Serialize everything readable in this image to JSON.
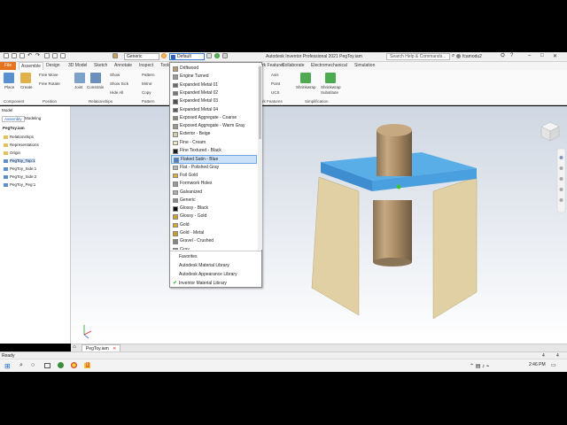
{
  "title_bar": {
    "material_combo": "Generic",
    "appearance_combo": "Default",
    "app_title": "Autodesk Inventor Professional 2021   PegToy.iam",
    "search_placeholder": "Search Help & Commands...",
    "user": "fcamodu2"
  },
  "ribbon_tabs": [
    "File",
    "Assemble",
    "Design",
    "3D Model",
    "Sketch",
    "Annotate",
    "Inspect",
    "Tools",
    "rk Features",
    "Collaborate",
    "Electromechanical",
    "Simulation"
  ],
  "ribbon": {
    "place": "Place",
    "create": "Create",
    "free_move": "Free Move",
    "free_rotate": "Free Rotate",
    "joint": "Joint",
    "constrain": "Constrain",
    "show": "Show",
    "show_sick": "Show Sick",
    "hide_all": "Hide All",
    "pattern": "Pattern",
    "mirror": "Mirror",
    "copy": "Copy",
    "axis": "Axis",
    "point": "Point",
    "ucs": "UCS",
    "shrinkwrap": "Shrinkwrap",
    "shrinkwrap_substitute": "Shrinkwrap Substitute",
    "panels": {
      "component": "Component",
      "position": "Position",
      "relationships": "Relationships",
      "pattern": "Pattern",
      "work_features": "rk Features",
      "simplification": "Simplification"
    }
  },
  "browser": {
    "tab_model": "Model",
    "tab_assembly": "Assembly",
    "tab_modeling": "Modeling",
    "root": "PegToy.iam",
    "items": [
      "Relationships",
      "Representations",
      "Origin",
      "PegToy_Top:1",
      "PegToy_Side:1",
      "PegToy_Side:2",
      "PegToy_Peg:1"
    ]
  },
  "appearance_dropdown": {
    "options": [
      {
        "label": "Driftwood",
        "color": "#b79b74"
      },
      {
        "label": "Engine Turned",
        "color": "#9a9a9a"
      },
      {
        "label": "Expanded Metal 01",
        "color": "#6b6b6b"
      },
      {
        "label": "Expanded Metal 02",
        "color": "#777777"
      },
      {
        "label": "Expanded Metal 03",
        "color": "#4f4f4f"
      },
      {
        "label": "Expanded Metal 04",
        "color": "#5d5d5d"
      },
      {
        "label": "Exposed Aggregate - Coarse",
        "color": "#8d8576"
      },
      {
        "label": "Exposed Aggregate - Warm Gray",
        "color": "#9e968a"
      },
      {
        "label": "Exterior - Beige",
        "color": "#d8c9a5"
      },
      {
        "label": "Fine - Cream",
        "color": "#efe6c8"
      },
      {
        "label": "Fine Textured - Black",
        "color": "#1d1d1d"
      },
      {
        "label": "Flaked Satin - Blue",
        "color": "#3f83d6"
      },
      {
        "label": "Flat - Polished Gray",
        "color": "#b5b5b5"
      },
      {
        "label": "Foil Gold",
        "color": "#d9b340"
      },
      {
        "label": "Formwork Holes",
        "color": "#9a9a9a"
      },
      {
        "label": "Galvanized",
        "color": "#a9adb0"
      },
      {
        "label": "Generic",
        "color": "#8b8b8b"
      },
      {
        "label": "Glossy - Black",
        "color": "#0d0d0d"
      },
      {
        "label": "Glossy - Gold",
        "color": "#c9a233"
      },
      {
        "label": "Gold",
        "color": "#d4aa2a"
      },
      {
        "label": "Gold - Metal",
        "color": "#c59d2a"
      },
      {
        "label": "Gravel - Crushed",
        "color": "#8a857b"
      },
      {
        "label": "Gray",
        "color": "#8a8a8a"
      }
    ],
    "selected": "Flaked Satin - Blue",
    "libraries": [
      "Favorites",
      "Autodesk Material Library",
      "Autodesk Appearance Library",
      "Inventor Material Library"
    ],
    "active_library": "Inventor Material Library"
  },
  "document_tab": "PegToy.iam",
  "status": "Ready",
  "status_numbers": [
    "4",
    "4"
  ],
  "clock": "2:46 PM"
}
